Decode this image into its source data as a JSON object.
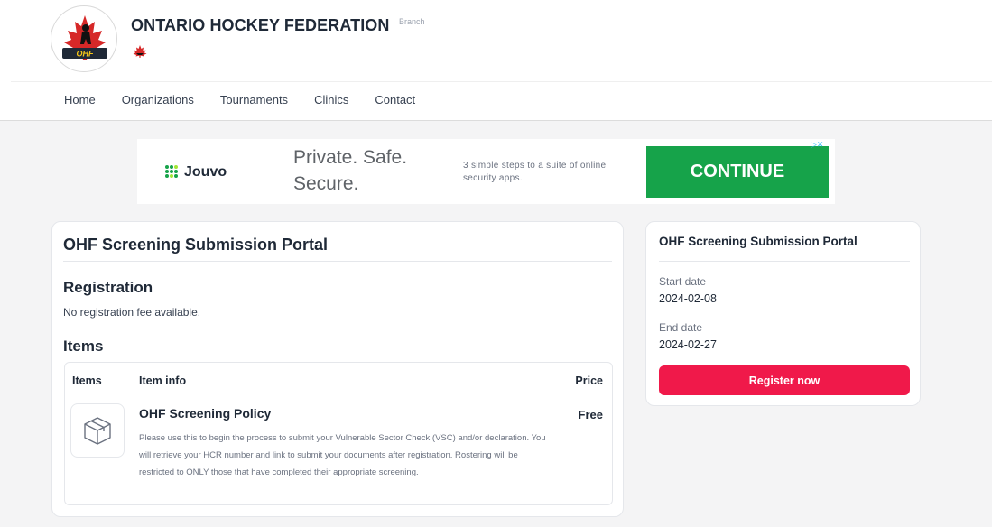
{
  "header": {
    "org_name": "ONTARIO HOCKEY FEDERATION",
    "branch_tag": "Branch",
    "logo_icon": "ohf-logo",
    "flag_icon": "hockey-canada-flag-icon"
  },
  "nav": {
    "items": [
      {
        "label": "Home"
      },
      {
        "label": "Organizations"
      },
      {
        "label": "Tournaments"
      },
      {
        "label": "Clinics"
      },
      {
        "label": "Contact"
      }
    ]
  },
  "ad": {
    "brand": "Jouvo",
    "headline": "Private. Safe. Secure.",
    "subtext": "3 simple steps to a suite of online security apps.",
    "cta": "CONTINUE",
    "adchoices": "▷✕",
    "cta_color": "#16a34a"
  },
  "main": {
    "title": "OHF Screening Submission Portal",
    "registration_heading": "Registration",
    "registration_text": "No registration fee available.",
    "items_heading": "Items",
    "table": {
      "headers": {
        "items": "Items",
        "info": "Item info",
        "price": "Price"
      },
      "rows": [
        {
          "name": "OHF Screening Policy",
          "price": "Free",
          "description": "Please use this to begin the process to submit your Vulnerable Sector Check (VSC) and/or declaration. You will retrieve your HCR number and link to submit your documents after registration. Rostering will be restricted to ONLY those that have completed their appropriate screening.",
          "icon": "box-icon"
        }
      ]
    }
  },
  "sidebar": {
    "title": "OHF Screening Submission Portal",
    "start_label": "Start date",
    "start_value": "2024-02-08",
    "end_label": "End date",
    "end_value": "2024-02-27",
    "register_label": "Register now",
    "register_color": "#f0194a"
  }
}
